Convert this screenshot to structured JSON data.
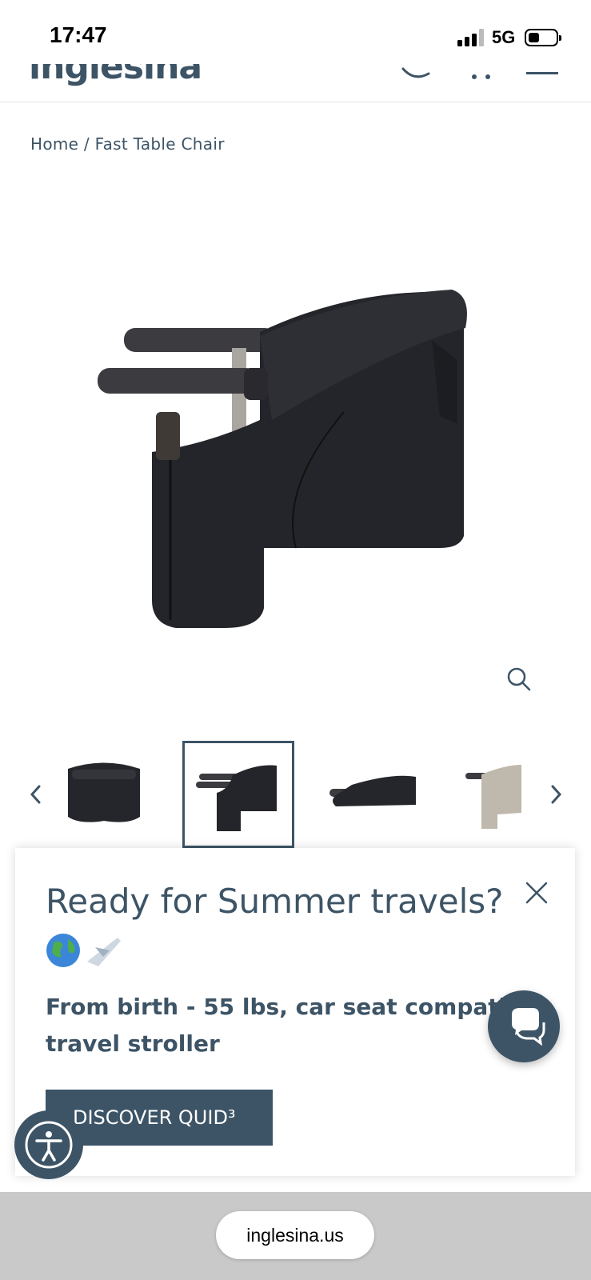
{
  "status_bar": {
    "time": "17:47",
    "network": "5G"
  },
  "header": {
    "logo": "inglesina"
  },
  "breadcrumb": {
    "home": "Home",
    "separator": " / ",
    "current": "Fast Table Chair"
  },
  "gallery": {
    "main_image": "fast-table-chair-black",
    "thumbnails": [
      "fast-table-chair-front",
      "fast-table-chair-side",
      "fast-table-chair-folded",
      "fast-table-chair-beige"
    ],
    "selected_index": 1
  },
  "popup": {
    "title": "Ready for Summer travels?",
    "subtitle": "From birth - 55 lbs, car seat compatible travel stroller",
    "cta_label": "DISCOVER QUID³"
  },
  "browser": {
    "url": "inglesina.us"
  },
  "colors": {
    "brand": "#3d5466",
    "browser_bar": "#c9c9c9"
  }
}
